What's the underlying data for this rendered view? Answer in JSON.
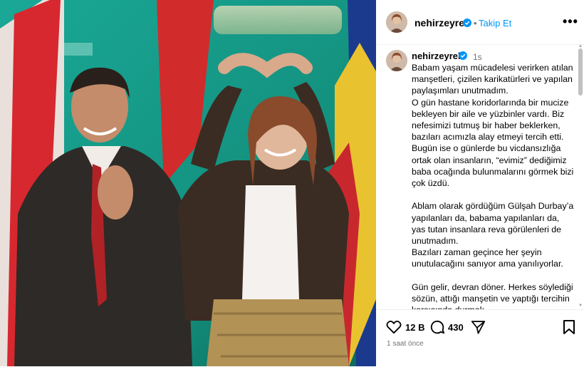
{
  "post": {
    "username": "nehirzeyrek",
    "follow_label": "Takip Et",
    "dot": "•",
    "more_label": "•••",
    "time_short": "1s",
    "caption": "Babam yaşam mücadelesi verirken atılan manşetleri, çizilen karikatürleri ve yapılan paylaşımları unutmadım.\nO gün hastane koridorlarında bir mucize bekleyen bir aile ve yüzbinler vardı. Biz nefesimizi tutmuş bir haber beklerken, bazıları acımızla alay etmeyi tercih etti. Bugün ise o günlerde bu vicdansızlığa ortak olan insanların, “evimiz” dediğimiz baba ocağında bulunmalarını görmek bizi çok üzdü.\n\nAblam olarak gördüğüm Gülşah Durbay’a yapılanları da, babama yapılanları da, yas tutan insanlara reva görülenleri de unutmadım.\nBazıları zaman geçince her şeyin unutulacağını sanıyor ama yanılıyorlar.\n\nGün gelir, devran döner. Herkes söylediği sözün, attığı manşetin ve yaptığı tercihin karşısında durmak",
    "likes": "12 B",
    "comments": "430",
    "time_ago": "1 saat önce"
  },
  "colors": {
    "link": "#0095f6",
    "verified": "#0095f6",
    "muted": "#737373",
    "divider": "#efefef"
  },
  "icons": [
    "verified-badge-icon",
    "more-options-icon",
    "heart-icon",
    "comment-icon",
    "share-icon",
    "bookmark-icon"
  ]
}
